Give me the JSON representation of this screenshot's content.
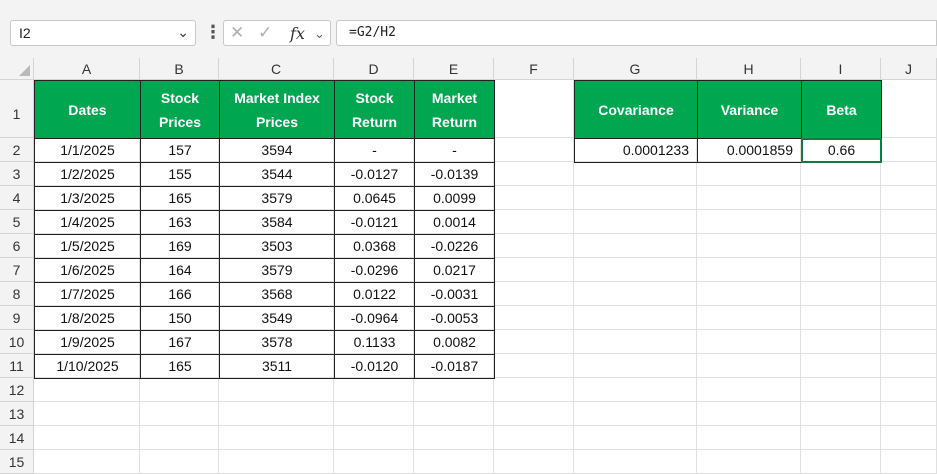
{
  "formula_bar": {
    "name_box": "I2",
    "formula": "=G2/H2"
  },
  "columns": [
    "A",
    "B",
    "C",
    "D",
    "E",
    "F",
    "G",
    "H",
    "I",
    "J"
  ],
  "rows": [
    "1",
    "2",
    "3",
    "4",
    "5",
    "6",
    "7",
    "8",
    "9",
    "10",
    "11",
    "12",
    "13",
    "14",
    "15"
  ],
  "table1": {
    "headers": [
      "Dates",
      "Stock\nPrices",
      "Market Index\nPrices",
      "Stock\nReturn",
      "Market\nReturn"
    ],
    "rows": [
      [
        "1/1/2025",
        "157",
        "3594",
        "-",
        "-"
      ],
      [
        "1/2/2025",
        "155",
        "3544",
        "-0.0127",
        "-0.0139"
      ],
      [
        "1/3/2025",
        "165",
        "3579",
        "0.0645",
        "0.0099"
      ],
      [
        "1/4/2025",
        "163",
        "3584",
        "-0.0121",
        "0.0014"
      ],
      [
        "1/5/2025",
        "169",
        "3503",
        "0.0368",
        "-0.0226"
      ],
      [
        "1/6/2025",
        "164",
        "3579",
        "-0.0296",
        "0.0217"
      ],
      [
        "1/7/2025",
        "166",
        "3568",
        "0.0122",
        "-0.0031"
      ],
      [
        "1/8/2025",
        "150",
        "3549",
        "-0.0964",
        "-0.0053"
      ],
      [
        "1/9/2025",
        "167",
        "3578",
        "0.1133",
        "0.0082"
      ],
      [
        "1/10/2025",
        "165",
        "3511",
        "-0.0120",
        "-0.0187"
      ]
    ]
  },
  "table2": {
    "headers": [
      "Covariance",
      "Variance",
      "Beta"
    ],
    "values": [
      "0.0001233",
      "0.0001859",
      "0.66"
    ]
  },
  "colors": {
    "header_green": "#00a650",
    "selection": "#107c41"
  }
}
